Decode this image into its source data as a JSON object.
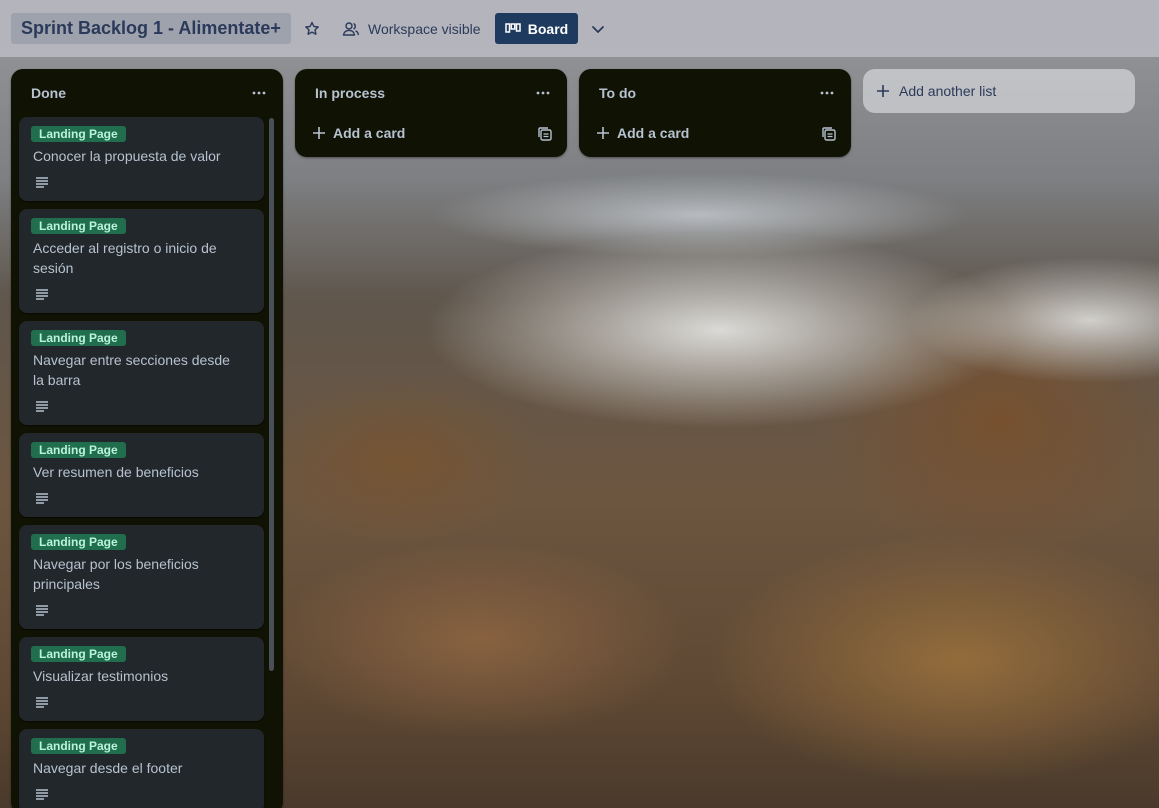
{
  "header": {
    "board_title": "Sprint Backlog 1 - Alimentate+",
    "star_icon": "star-icon",
    "visibility_label": "Workspace visible",
    "view_label": "Board",
    "view_chevron_icon": "chevron-down-icon"
  },
  "lists": [
    {
      "title": "Done",
      "cards": [
        {
          "label": "Landing Page",
          "title": "Conocer la propuesta de valor",
          "has_description": true
        },
        {
          "label": "Landing Page",
          "title": "Acceder al registro o inicio de sesión",
          "has_description": true
        },
        {
          "label": "Landing Page",
          "title": "Navegar entre secciones desde la barra",
          "has_description": true
        },
        {
          "label": "Landing Page",
          "title": "Ver resumen de beneficios",
          "has_description": true
        },
        {
          "label": "Landing Page",
          "title": "Navegar por los beneficios principales",
          "has_description": true
        },
        {
          "label": "Landing Page",
          "title": "Visualizar testimonios",
          "has_description": true
        },
        {
          "label": "Landing Page",
          "title": "Navegar desde el footer",
          "has_description": true
        }
      ]
    },
    {
      "title": "In process",
      "add_card_label": "Add a card"
    },
    {
      "title": "To do",
      "add_card_label": "Add a card"
    }
  ],
  "add_list_label": "Add another list",
  "colors": {
    "list_bg": "#101204",
    "card_bg": "#22272b",
    "label_bg": "#216e4e",
    "label_text": "#baf3db",
    "board_button_bg": "#1f3a5f"
  }
}
